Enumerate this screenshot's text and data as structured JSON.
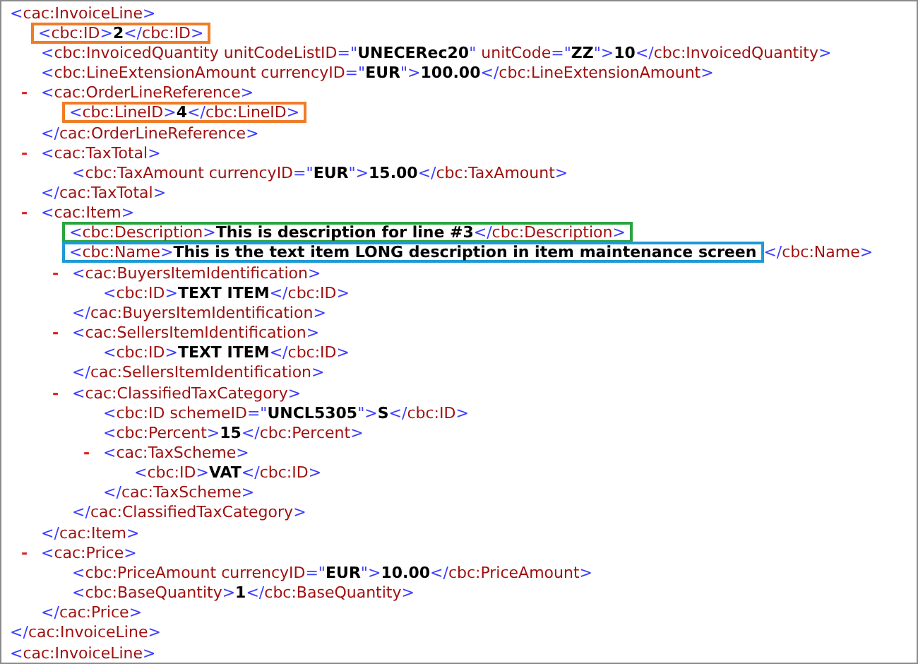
{
  "nodes": [
    {
      "line": [
        {
          "kind": "mark",
          "text": "<"
        },
        {
          "kind": "name",
          "text": "cac:InvoiceLine"
        },
        {
          "kind": "mark",
          "text": ">"
        }
      ],
      "children": [
        {
          "highlight": {
            "color": "#f07c28",
            "segments": [
              {
                "kind": "mark",
                "text": "<"
              },
              {
                "kind": "name",
                "text": "cbc:ID"
              },
              {
                "kind": "mark",
                "text": ">"
              },
              {
                "kind": "value",
                "text": "2"
              },
              {
                "kind": "mark",
                "text": "</"
              },
              {
                "kind": "name",
                "text": "cbc:ID"
              },
              {
                "kind": "mark",
                "text": ">"
              }
            ]
          }
        },
        {
          "line": [
            {
              "kind": "mark",
              "text": "<"
            },
            {
              "kind": "name",
              "text": "cbc:InvoicedQuantity"
            },
            {
              "kind": "name",
              "text": " unitCodeListID"
            },
            {
              "kind": "mark",
              "text": "=\""
            },
            {
              "kind": "value",
              "text": "UNECERec20"
            },
            {
              "kind": "mark",
              "text": "\""
            },
            {
              "kind": "name",
              "text": " unitCode"
            },
            {
              "kind": "mark",
              "text": "=\""
            },
            {
              "kind": "value",
              "text": "ZZ"
            },
            {
              "kind": "mark",
              "text": "\">"
            },
            {
              "kind": "value",
              "text": "10"
            },
            {
              "kind": "mark",
              "text": "</"
            },
            {
              "kind": "name",
              "text": "cbc:InvoicedQuantity"
            },
            {
              "kind": "mark",
              "text": ">"
            }
          ]
        },
        {
          "line": [
            {
              "kind": "mark",
              "text": "<"
            },
            {
              "kind": "name",
              "text": "cbc:LineExtensionAmount"
            },
            {
              "kind": "name",
              "text": " currencyID"
            },
            {
              "kind": "mark",
              "text": "=\""
            },
            {
              "kind": "value",
              "text": "EUR"
            },
            {
              "kind": "mark",
              "text": "\">"
            },
            {
              "kind": "value",
              "text": "100.00"
            },
            {
              "kind": "mark",
              "text": "</"
            },
            {
              "kind": "name",
              "text": "cbc:LineExtensionAmount"
            },
            {
              "kind": "mark",
              "text": ">"
            }
          ]
        },
        {
          "toggle": "-",
          "line": [
            {
              "kind": "mark",
              "text": "<"
            },
            {
              "kind": "name",
              "text": "cac:OrderLineReference"
            },
            {
              "kind": "mark",
              "text": ">"
            }
          ],
          "children": [
            {
              "highlight": {
                "color": "#f07c28",
                "segments": [
                  {
                    "kind": "mark",
                    "text": "<"
                  },
                  {
                    "kind": "name",
                    "text": "cbc:LineID"
                  },
                  {
                    "kind": "mark",
                    "text": ">"
                  },
                  {
                    "kind": "value",
                    "text": "4"
                  },
                  {
                    "kind": "mark",
                    "text": "</"
                  },
                  {
                    "kind": "name",
                    "text": "cbc:LineID"
                  },
                  {
                    "kind": "mark",
                    "text": ">"
                  }
                ]
              }
            }
          ],
          "end": [
            {
              "kind": "mark",
              "text": "</"
            },
            {
              "kind": "name",
              "text": "cac:OrderLineReference"
            },
            {
              "kind": "mark",
              "text": ">"
            }
          ]
        },
        {
          "toggle": "-",
          "line": [
            {
              "kind": "mark",
              "text": "<"
            },
            {
              "kind": "name",
              "text": "cac:TaxTotal"
            },
            {
              "kind": "mark",
              "text": ">"
            }
          ],
          "children": [
            {
              "line": [
                {
                  "kind": "mark",
                  "text": "<"
                },
                {
                  "kind": "name",
                  "text": "cbc:TaxAmount"
                },
                {
                  "kind": "name",
                  "text": " currencyID"
                },
                {
                  "kind": "mark",
                  "text": "=\""
                },
                {
                  "kind": "value",
                  "text": "EUR"
                },
                {
                  "kind": "mark",
                  "text": "\">"
                },
                {
                  "kind": "value",
                  "text": "15.00"
                },
                {
                  "kind": "mark",
                  "text": "</"
                },
                {
                  "kind": "name",
                  "text": "cbc:TaxAmount"
                },
                {
                  "kind": "mark",
                  "text": ">"
                }
              ]
            }
          ],
          "end": [
            {
              "kind": "mark",
              "text": "</"
            },
            {
              "kind": "name",
              "text": "cac:TaxTotal"
            },
            {
              "kind": "mark",
              "text": ">"
            }
          ]
        },
        {
          "toggle": "-",
          "line": [
            {
              "kind": "mark",
              "text": "<"
            },
            {
              "kind": "name",
              "text": "cac:Item"
            },
            {
              "kind": "mark",
              "text": ">"
            }
          ],
          "children": [
            {
              "highlight": {
                "color": "#2aa53e",
                "segments": [
                  {
                    "kind": "mark",
                    "text": "<"
                  },
                  {
                    "kind": "name",
                    "text": "cbc:Description"
                  },
                  {
                    "kind": "mark",
                    "text": ">"
                  },
                  {
                    "kind": "value",
                    "text": "This is description for line #3"
                  },
                  {
                    "kind": "mark",
                    "text": "</"
                  },
                  {
                    "kind": "name",
                    "text": "cbc:Description"
                  },
                  {
                    "kind": "mark",
                    "text": ">"
                  }
                ]
              }
            },
            {
              "highlight": {
                "color": "#1e9ad6",
                "segments": [
                  {
                    "kind": "mark",
                    "text": "<"
                  },
                  {
                    "kind": "name",
                    "text": "cbc:Name"
                  },
                  {
                    "kind": "mark",
                    "text": ">"
                  },
                  {
                    "kind": "value",
                    "text": "This is the text item LONG description in item maintenance screen"
                  }
                ]
              },
              "line": [
                {
                  "kind": "mark",
                  "text": "</"
                },
                {
                  "kind": "name",
                  "text": "cbc:Name"
                },
                {
                  "kind": "mark",
                  "text": ">"
                }
              ]
            },
            {
              "toggle": "-",
              "line": [
                {
                  "kind": "mark",
                  "text": "<"
                },
                {
                  "kind": "name",
                  "text": "cac:BuyersItemIdentification"
                },
                {
                  "kind": "mark",
                  "text": ">"
                }
              ],
              "children": [
                {
                  "line": [
                    {
                      "kind": "mark",
                      "text": "<"
                    },
                    {
                      "kind": "name",
                      "text": "cbc:ID"
                    },
                    {
                      "kind": "mark",
                      "text": ">"
                    },
                    {
                      "kind": "value",
                      "text": "TEXT ITEM"
                    },
                    {
                      "kind": "mark",
                      "text": "</"
                    },
                    {
                      "kind": "name",
                      "text": "cbc:ID"
                    },
                    {
                      "kind": "mark",
                      "text": ">"
                    }
                  ]
                }
              ],
              "end": [
                {
                  "kind": "mark",
                  "text": "</"
                },
                {
                  "kind": "name",
                  "text": "cac:BuyersItemIdentification"
                },
                {
                  "kind": "mark",
                  "text": ">"
                }
              ]
            },
            {
              "toggle": "-",
              "line": [
                {
                  "kind": "mark",
                  "text": "<"
                },
                {
                  "kind": "name",
                  "text": "cac:SellersItemIdentification"
                },
                {
                  "kind": "mark",
                  "text": ">"
                }
              ],
              "children": [
                {
                  "line": [
                    {
                      "kind": "mark",
                      "text": "<"
                    },
                    {
                      "kind": "name",
                      "text": "cbc:ID"
                    },
                    {
                      "kind": "mark",
                      "text": ">"
                    },
                    {
                      "kind": "value",
                      "text": "TEXT ITEM"
                    },
                    {
                      "kind": "mark",
                      "text": "</"
                    },
                    {
                      "kind": "name",
                      "text": "cbc:ID"
                    },
                    {
                      "kind": "mark",
                      "text": ">"
                    }
                  ]
                }
              ],
              "end": [
                {
                  "kind": "mark",
                  "text": "</"
                },
                {
                  "kind": "name",
                  "text": "cac:SellersItemIdentification"
                },
                {
                  "kind": "mark",
                  "text": ">"
                }
              ]
            },
            {
              "toggle": "-",
              "line": [
                {
                  "kind": "mark",
                  "text": "<"
                },
                {
                  "kind": "name",
                  "text": "cac:ClassifiedTaxCategory"
                },
                {
                  "kind": "mark",
                  "text": ">"
                }
              ],
              "children": [
                {
                  "line": [
                    {
                      "kind": "mark",
                      "text": "<"
                    },
                    {
                      "kind": "name",
                      "text": "cbc:ID"
                    },
                    {
                      "kind": "name",
                      "text": " schemeID"
                    },
                    {
                      "kind": "mark",
                      "text": "=\""
                    },
                    {
                      "kind": "value",
                      "text": "UNCL5305"
                    },
                    {
                      "kind": "mark",
                      "text": "\">"
                    },
                    {
                      "kind": "value",
                      "text": "S"
                    },
                    {
                      "kind": "mark",
                      "text": "</"
                    },
                    {
                      "kind": "name",
                      "text": "cbc:ID"
                    },
                    {
                      "kind": "mark",
                      "text": ">"
                    }
                  ]
                },
                {
                  "line": [
                    {
                      "kind": "mark",
                      "text": "<"
                    },
                    {
                      "kind": "name",
                      "text": "cbc:Percent"
                    },
                    {
                      "kind": "mark",
                      "text": ">"
                    },
                    {
                      "kind": "value",
                      "text": "15"
                    },
                    {
                      "kind": "mark",
                      "text": "</"
                    },
                    {
                      "kind": "name",
                      "text": "cbc:Percent"
                    },
                    {
                      "kind": "mark",
                      "text": ">"
                    }
                  ]
                },
                {
                  "toggle": "-",
                  "line": [
                    {
                      "kind": "mark",
                      "text": "<"
                    },
                    {
                      "kind": "name",
                      "text": "cac:TaxScheme"
                    },
                    {
                      "kind": "mark",
                      "text": ">"
                    }
                  ],
                  "children": [
                    {
                      "line": [
                        {
                          "kind": "mark",
                          "text": "<"
                        },
                        {
                          "kind": "name",
                          "text": "cbc:ID"
                        },
                        {
                          "kind": "mark",
                          "text": ">"
                        },
                        {
                          "kind": "value",
                          "text": "VAT"
                        },
                        {
                          "kind": "mark",
                          "text": "</"
                        },
                        {
                          "kind": "name",
                          "text": "cbc:ID"
                        },
                        {
                          "kind": "mark",
                          "text": ">"
                        }
                      ]
                    }
                  ],
                  "end": [
                    {
                      "kind": "mark",
                      "text": "</"
                    },
                    {
                      "kind": "name",
                      "text": "cac:TaxScheme"
                    },
                    {
                      "kind": "mark",
                      "text": ">"
                    }
                  ]
                }
              ],
              "end": [
                {
                  "kind": "mark",
                  "text": "</"
                },
                {
                  "kind": "name",
                  "text": "cac:ClassifiedTaxCategory"
                },
                {
                  "kind": "mark",
                  "text": ">"
                }
              ]
            }
          ],
          "end": [
            {
              "kind": "mark",
              "text": "</"
            },
            {
              "kind": "name",
              "text": "cac:Item"
            },
            {
              "kind": "mark",
              "text": ">"
            }
          ]
        },
        {
          "toggle": "-",
          "line": [
            {
              "kind": "mark",
              "text": "<"
            },
            {
              "kind": "name",
              "text": "cac:Price"
            },
            {
              "kind": "mark",
              "text": ">"
            }
          ],
          "children": [
            {
              "line": [
                {
                  "kind": "mark",
                  "text": "<"
                },
                {
                  "kind": "name",
                  "text": "cbc:PriceAmount"
                },
                {
                  "kind": "name",
                  "text": " currencyID"
                },
                {
                  "kind": "mark",
                  "text": "=\""
                },
                {
                  "kind": "value",
                  "text": "EUR"
                },
                {
                  "kind": "mark",
                  "text": "\">"
                },
                {
                  "kind": "value",
                  "text": "10.00"
                },
                {
                  "kind": "mark",
                  "text": "</"
                },
                {
                  "kind": "name",
                  "text": "cbc:PriceAmount"
                },
                {
                  "kind": "mark",
                  "text": ">"
                }
              ]
            },
            {
              "line": [
                {
                  "kind": "mark",
                  "text": "<"
                },
                {
                  "kind": "name",
                  "text": "cbc:BaseQuantity"
                },
                {
                  "kind": "mark",
                  "text": ">"
                },
                {
                  "kind": "value",
                  "text": "1"
                },
                {
                  "kind": "mark",
                  "text": "</"
                },
                {
                  "kind": "name",
                  "text": "cbc:BaseQuantity"
                },
                {
                  "kind": "mark",
                  "text": ">"
                }
              ]
            }
          ],
          "end": [
            {
              "kind": "mark",
              "text": "</"
            },
            {
              "kind": "name",
              "text": "cac:Price"
            },
            {
              "kind": "mark",
              "text": ">"
            }
          ]
        }
      ],
      "end": [
        {
          "kind": "mark",
          "text": "</"
        },
        {
          "kind": "name",
          "text": "cac:InvoiceLine"
        },
        {
          "kind": "mark",
          "text": ">"
        }
      ]
    },
    {
      "line": [
        {
          "kind": "mark",
          "text": "<"
        },
        {
          "kind": "name",
          "text": "cac:InvoiceLine"
        },
        {
          "kind": "mark",
          "text": ">"
        }
      ]
    }
  ]
}
